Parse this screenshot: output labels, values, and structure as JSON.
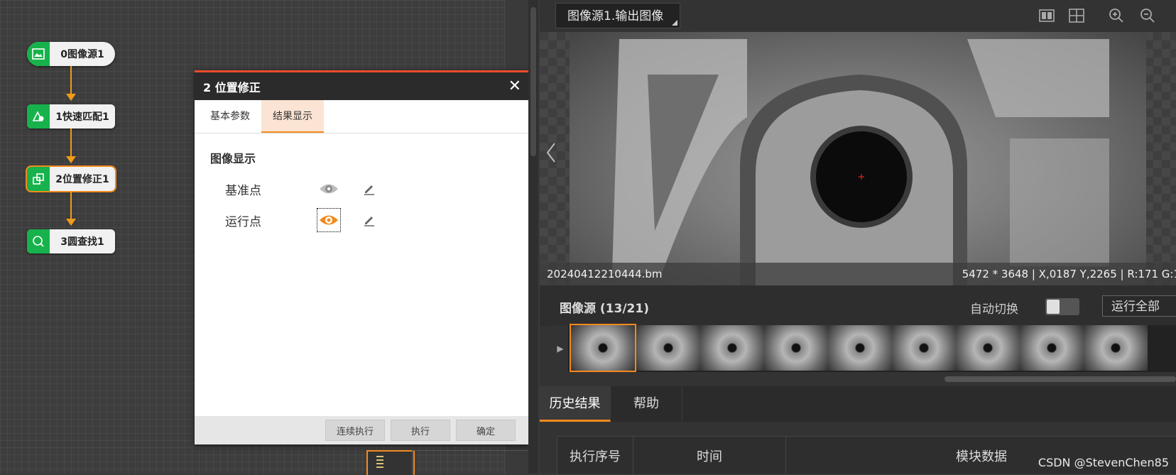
{
  "flow": {
    "nodes": [
      {
        "label": "0图像源1",
        "icon": "image-icon"
      },
      {
        "label": "1快速匹配1",
        "icon": "shape-match-icon"
      },
      {
        "label": "2位置修正1",
        "icon": "position-correct-icon"
      },
      {
        "label": "3圆查找1",
        "icon": "circle-find-icon"
      }
    ]
  },
  "dialog": {
    "title": "2 位置修正",
    "close": "✕",
    "tabs": [
      "基本参数",
      "结果显示"
    ],
    "active_tab": "结果显示",
    "section_title": "图像显示",
    "rows": [
      {
        "label": "基准点",
        "visible": false
      },
      {
        "label": "运行点",
        "visible": true
      }
    ],
    "buttons": {
      "continuous": "连续执行",
      "execute": "执行",
      "confirm": "确定"
    }
  },
  "viewer": {
    "tab": "图像源1.输出图像",
    "filename": "20240412210444.bm",
    "info": "5472 * 3648  |  X,0187  Y,2265  |  R:171  G:1"
  },
  "source": {
    "title": "图像源 (13/21)",
    "auto_switch": "自动切换",
    "run_all": "运行全部"
  },
  "history": {
    "tabs": [
      "历史结果",
      "帮助"
    ],
    "columns": [
      "执行序号",
      "时间",
      "模块数据"
    ]
  },
  "watermark": "CSDN @StevenChen85",
  "colors": {
    "accent": "#f28a1d",
    "node_icon": "#17b24b",
    "dialog_border": "#e84c2b"
  }
}
